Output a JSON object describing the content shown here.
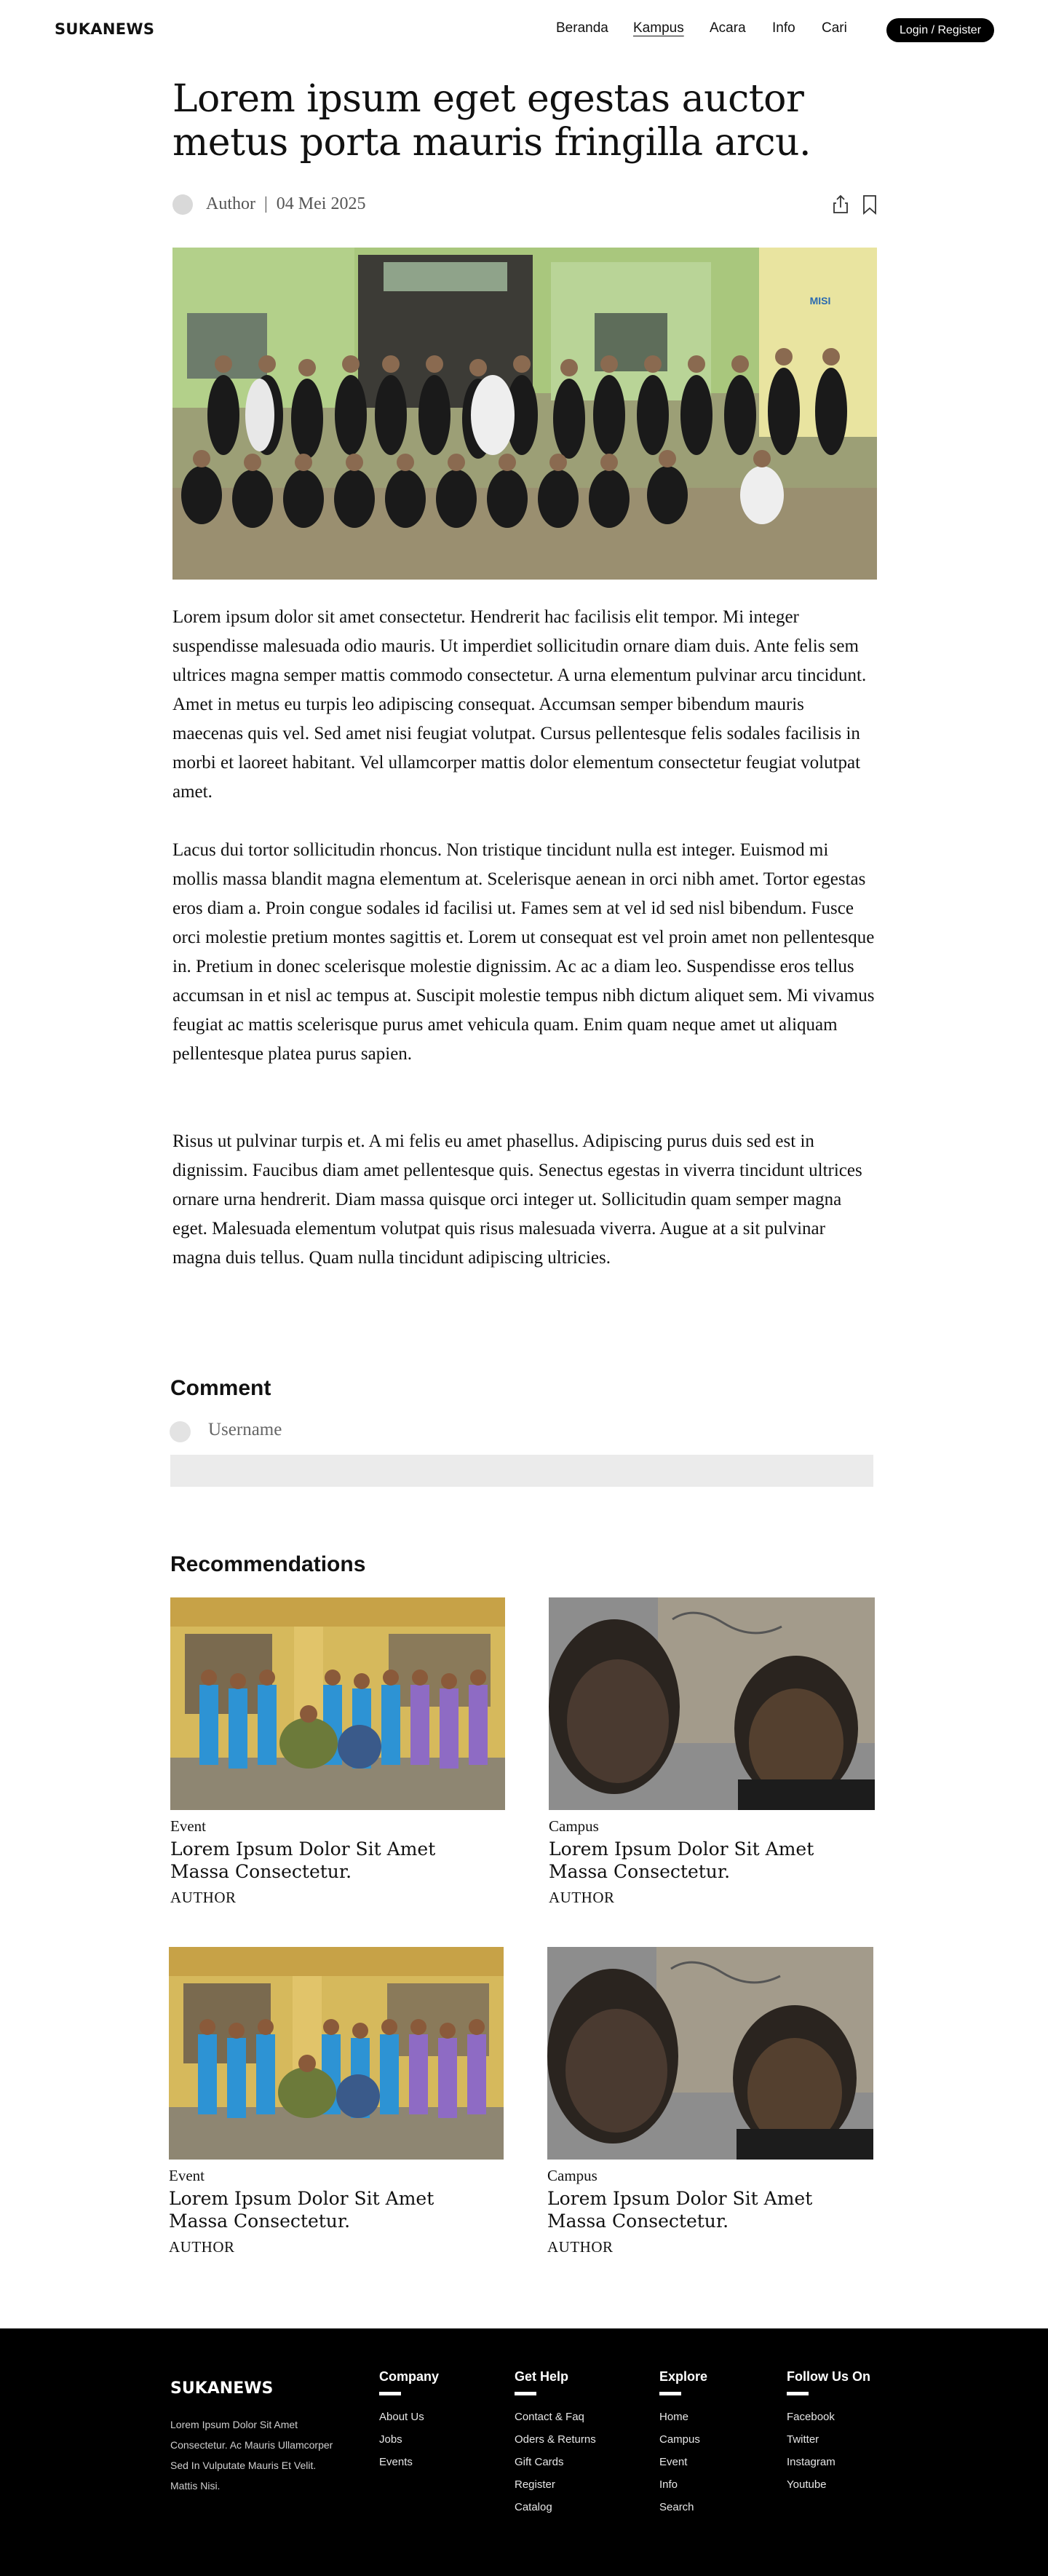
{
  "header": {
    "brand": "SUKANEWS",
    "nav": [
      "Beranda",
      "Kampus",
      "Acara",
      "Info",
      "Cari"
    ],
    "active_nav": "Kampus",
    "login_label": "Login / Register"
  },
  "article": {
    "title": "Lorem ipsum eget egestas auctor metus porta mauris fringilla arcu.",
    "author": "Author",
    "date": "04 Mei 2025",
    "meta": "Author  |  04 Mei 2025",
    "paragraphs": [
      "Lorem ipsum dolor sit amet consectetur. Hendrerit hac facilisis elit tempor. Mi integer suspendisse malesuada odio mauris. Ut imperdiet sollicitudin ornare diam duis. Ante felis sem ultrices magna semper mattis commodo consectetur. A urna elementum pulvinar arcu tincidunt. Amet in metus eu turpis leo adipiscing consequat. Accumsan semper bibendum mauris maecenas quis vel. Sed amet nisi feugiat volutpat. Cursus pellentesque felis sodales facilisis in morbi et laoreet habitant. Vel ullamcorper mattis dolor elementum consectetur feugiat volutpat amet.",
      "Lacus dui tortor sollicitudin rhoncus. Non tristique tincidunt nulla est integer. Euismod mi mollis massa blandit magna elementum at. Scelerisque aenean in orci nibh amet. Tortor egestas eros diam a. Proin congue sodales id facilisi ut. Fames sem at vel id sed nisl bibendum. Fusce orci molestie pretium montes sagittis et. Lorem ut consequat est vel proin amet non pellentesque in. Pretium in donec scelerisque molestie dignissim. Ac ac a diam leo. Suspendisse eros tellus accumsan in et nisl ac tempus at. Suscipit molestie tempus nibh dictum aliquet sem. Mi vivamus feugiat ac mattis scelerisque purus amet vehicula quam. Enim quam neque amet ut aliquam pellentesque platea purus sapien.",
      "Risus ut pulvinar turpis et. A mi felis eu amet phasellus. Adipiscing purus duis sed est in dignissim. Faucibus diam amet pellentesque quis. Senectus egestas in viverra tincidunt ultrices ornare urna hendrerit. Diam massa quisque orci integer ut. Sollicitudin quam semper magna eget. Malesuada elementum volutpat quis risus malesuada viverra. Augue at a sit pulvinar magna duis tellus. Quam nulla tincidunt adipiscing ultricies."
    ],
    "hero_sign_text": "MISI"
  },
  "comment": {
    "title": "Comment",
    "username": "Username",
    "input_value": ""
  },
  "recommendations": {
    "title": "Recommendations",
    "cards": [
      {
        "category": "Event",
        "title": "Lorem Ipsum Dolor Sit Amet Massa Consectetur.",
        "author": "AUTHOR"
      },
      {
        "category": "Campus",
        "title": "Lorem Ipsum Dolor Sit Amet Massa Consectetur.",
        "author": "AUTHOR"
      },
      {
        "category": "Event",
        "title": "Lorem Ipsum Dolor Sit Amet Massa Consectetur.",
        "author": "AUTHOR"
      },
      {
        "category": "Campus",
        "title": "Lorem Ipsum Dolor Sit Amet Massa Consectetur.",
        "author": "AUTHOR"
      }
    ]
  },
  "footer": {
    "brand": "SUKANEWS",
    "description": "Lorem Ipsum Dolor Sit Amet Consectetur. Ac Mauris Ullamcorper Sed In Vulputate Mauris Et Velit. Mattis Nisi.",
    "columns": [
      {
        "title": "Company",
        "links": [
          "About Us",
          "Jobs",
          "Events"
        ]
      },
      {
        "title": "Get Help",
        "links": [
          "Contact & Faq",
          "Oders & Returns",
          "Gift Cards",
          "Register",
          "Catalog"
        ]
      },
      {
        "title": "Explore",
        "links": [
          "Home",
          "Campus",
          "Event",
          "Info",
          "Search"
        ]
      },
      {
        "title": "Follow Us On",
        "links": [
          "Facebook",
          "Twitter",
          "Instagram",
          "Youtube"
        ]
      }
    ]
  },
  "colors": {
    "footer_bg": "#000000",
    "placeholder_gray": "#d9d9d9",
    "input_bg": "#ebebeb"
  }
}
